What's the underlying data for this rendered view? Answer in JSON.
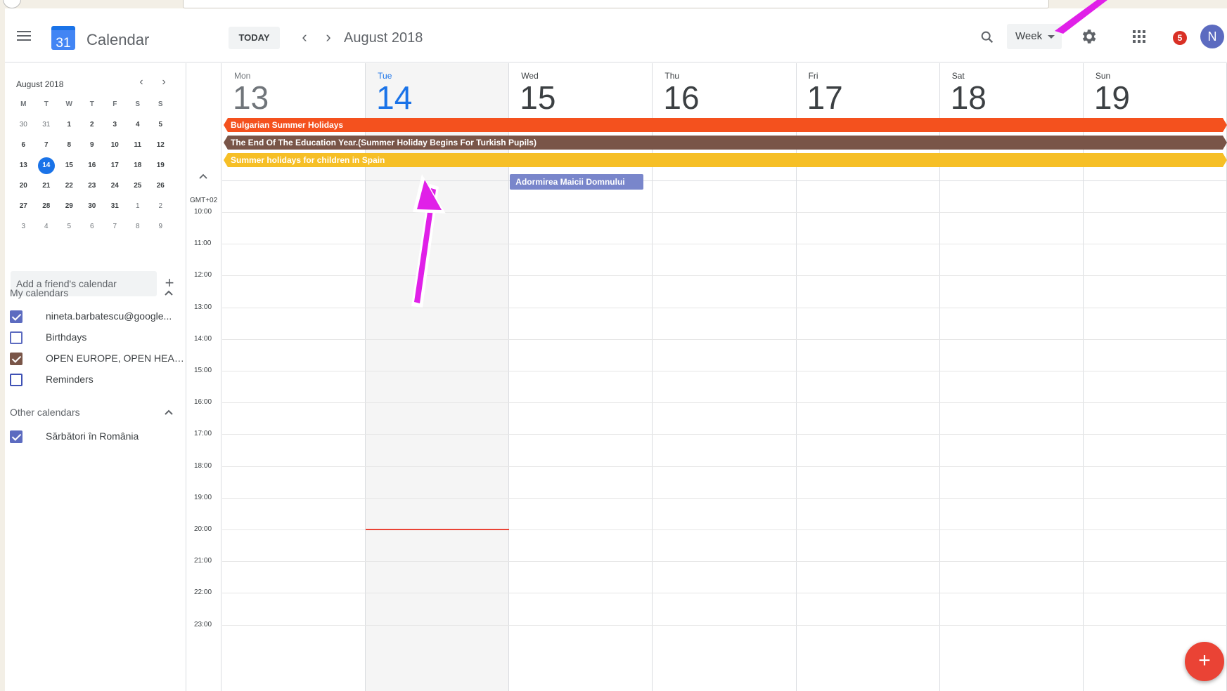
{
  "header": {
    "app_title": "Calendar",
    "logo_day": "31",
    "today_label": "TODAY",
    "period_title": "August 2018",
    "view_label": "Week",
    "notification_count": "5",
    "avatar_initial": "N"
  },
  "mini_calendar": {
    "title": "August 2018",
    "weekday_heads": [
      "M",
      "T",
      "W",
      "T",
      "F",
      "S",
      "S"
    ],
    "weeks": [
      [
        "30",
        "31",
        "1",
        "2",
        "3",
        "4",
        "5"
      ],
      [
        "6",
        "7",
        "8",
        "9",
        "10",
        "11",
        "12"
      ],
      [
        "13",
        "14",
        "15",
        "16",
        "17",
        "18",
        "19"
      ],
      [
        "20",
        "21",
        "22",
        "23",
        "24",
        "25",
        "26"
      ],
      [
        "27",
        "28",
        "29",
        "30",
        "31",
        "1",
        "2"
      ],
      [
        "3",
        "4",
        "5",
        "6",
        "7",
        "8",
        "9"
      ]
    ],
    "today": "14"
  },
  "sidebar": {
    "friend_placeholder": "Add a friend's calendar",
    "my_calendars_label": "My calendars",
    "my_calendars": [
      {
        "label": "nineta.barbatescu@google...",
        "checked": true,
        "color": "#5c6bc0"
      },
      {
        "label": "Birthdays",
        "checked": false,
        "color": "#5c6bc0"
      },
      {
        "label": "OPEN EUROPE, OPEN HEAR...",
        "checked": true,
        "color": "#795548"
      },
      {
        "label": "Reminders",
        "checked": false,
        "color": "#3f51b5"
      }
    ],
    "other_calendars_label": "Other calendars",
    "other_calendars": [
      {
        "label": "Sărbători în România",
        "checked": true,
        "color": "#5c6bc0"
      }
    ]
  },
  "week": {
    "timezone": "GMT+02",
    "days": [
      {
        "name": "Mon",
        "num": "13"
      },
      {
        "name": "Tue",
        "num": "14"
      },
      {
        "name": "Wed",
        "num": "15"
      },
      {
        "name": "Thu",
        "num": "16"
      },
      {
        "name": "Fri",
        "num": "17"
      },
      {
        "name": "Sat",
        "num": "18"
      },
      {
        "name": "Sun",
        "num": "19"
      }
    ],
    "today_index": 1,
    "hours": [
      "10:00",
      "11:00",
      "12:00",
      "13:00",
      "14:00",
      "15:00",
      "16:00",
      "17:00",
      "18:00",
      "19:00",
      "20:00",
      "21:00",
      "22:00",
      "23:00"
    ],
    "all_day_events": [
      {
        "title": "Bulgarian Summer Holidays",
        "color": "#f4511e"
      },
      {
        "title": "The End Of The Education Year.(Summer Holiday Begins For Turkish Pupils)",
        "color": "#795548"
      },
      {
        "title": "Summer holidays for children in Spain",
        "color": "#f6bf26"
      }
    ],
    "single_day_event": {
      "title": "Adormirea Maicii Domnului",
      "day": "Wed",
      "color": "#7986cb"
    }
  },
  "colors": {
    "accent": "#1a73e8",
    "annotation_arrow": "#e020e8",
    "fab": "#ea4335"
  }
}
